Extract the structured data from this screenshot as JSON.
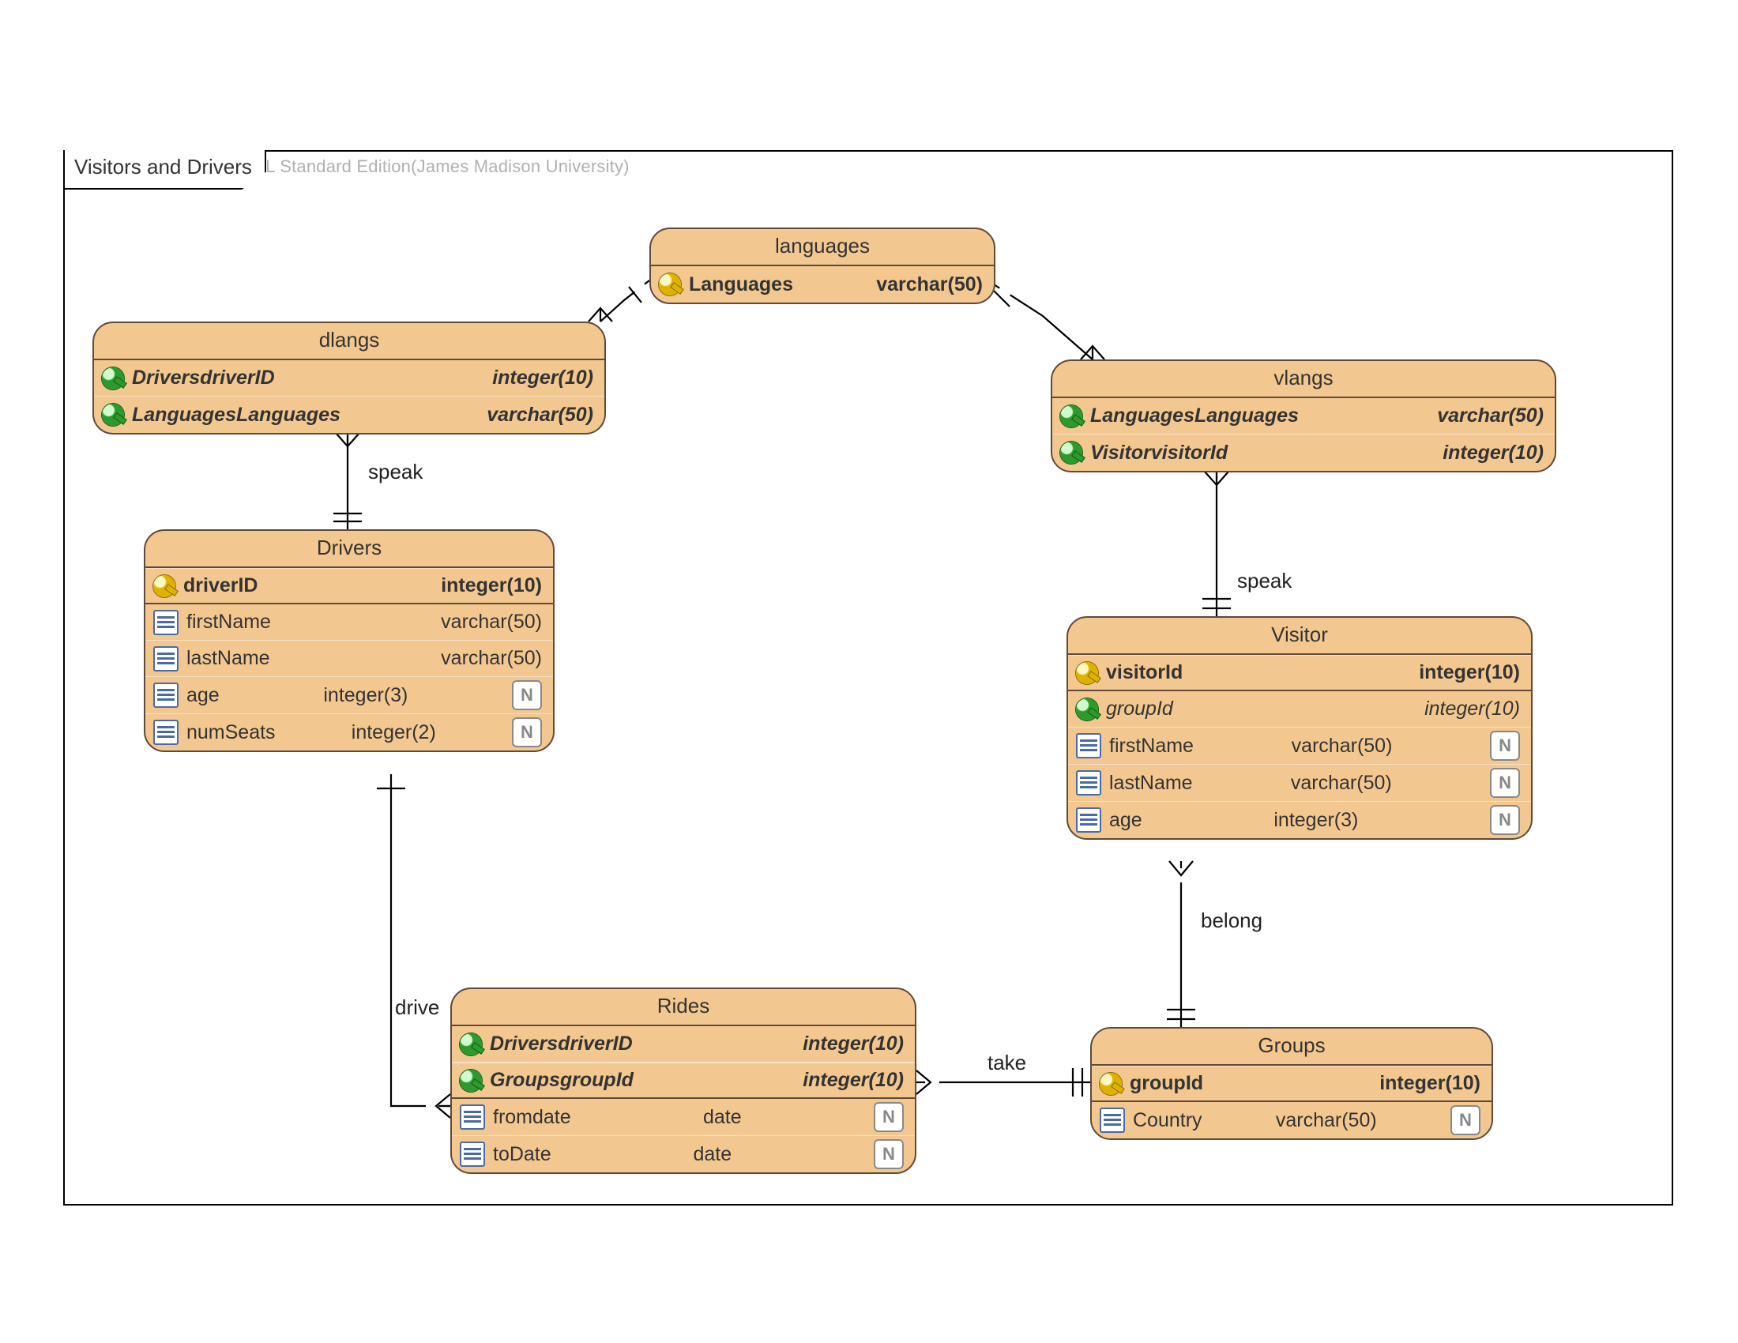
{
  "watermark": "Visual Paradigm for UML Standard Edition(James Madison University)",
  "frame_title": "Visitors and Drivers",
  "relationships": {
    "drivers_dlangs": "speak",
    "vlangs_visitor": "speak",
    "drivers_rides": "drive",
    "groups_rides": "take",
    "visitor_groups": "belong"
  },
  "entities": {
    "languages": {
      "title": "languages",
      "rows": [
        {
          "icon": "pk",
          "name": "Languages",
          "type": "varchar(50)",
          "bold": true
        }
      ]
    },
    "dlangs": {
      "title": "dlangs",
      "rows": [
        {
          "icon": "fk",
          "name": "DriversdriverID",
          "type": "integer(10)",
          "bold": true,
          "italic": true
        },
        {
          "icon": "fk",
          "name": "LanguagesLanguages",
          "type": "varchar(50)",
          "bold": true,
          "italic": true
        }
      ]
    },
    "vlangs": {
      "title": "vlangs",
      "rows": [
        {
          "icon": "fk",
          "name": "LanguagesLanguages",
          "type": "varchar(50)",
          "bold": true,
          "italic": true
        },
        {
          "icon": "fk",
          "name": "VisitorvisitorId",
          "type": "integer(10)",
          "bold": true,
          "italic": true
        }
      ]
    },
    "drivers": {
      "title": "Drivers",
      "rows": [
        {
          "icon": "pk",
          "name": "driverID",
          "type": "integer(10)",
          "bold": true,
          "pkrow": true
        },
        {
          "icon": "col",
          "name": "firstName",
          "type": "varchar(50)"
        },
        {
          "icon": "col",
          "name": "lastName",
          "type": "varchar(50)"
        },
        {
          "icon": "col",
          "name": "age",
          "type": "integer(3)",
          "null": true
        },
        {
          "icon": "col",
          "name": "numSeats",
          "type": "integer(2)",
          "null": true
        }
      ]
    },
    "visitor": {
      "title": "Visitor",
      "rows": [
        {
          "icon": "pk",
          "name": "visitorId",
          "type": "integer(10)",
          "bold": true,
          "pkrow": true
        },
        {
          "icon": "fk",
          "name": "groupId",
          "type": "integer(10)",
          "italic": true
        },
        {
          "icon": "col",
          "name": "firstName",
          "type": "varchar(50)",
          "null": true
        },
        {
          "icon": "col",
          "name": "lastName",
          "type": "varchar(50)",
          "null": true
        },
        {
          "icon": "col",
          "name": "age",
          "type": "integer(3)",
          "null": true
        }
      ]
    },
    "rides": {
      "title": "Rides",
      "rows": [
        {
          "icon": "fk",
          "name": "DriversdriverID",
          "type": "integer(10)",
          "bold": true,
          "italic": true
        },
        {
          "icon": "fk",
          "name": "GroupsgroupId",
          "type": "integer(10)",
          "bold": true,
          "italic": true,
          "pkrow": true
        },
        {
          "icon": "col",
          "name": "fromdate",
          "type": "date",
          "null": true
        },
        {
          "icon": "col",
          "name": "toDate",
          "type": "date",
          "null": true
        }
      ]
    },
    "groups": {
      "title": "Groups",
      "rows": [
        {
          "icon": "pk",
          "name": "groupId",
          "type": "integer(10)",
          "bold": true,
          "pkrow": true
        },
        {
          "icon": "col",
          "name": "Country",
          "type": "varchar(50)",
          "null": true
        }
      ]
    }
  }
}
